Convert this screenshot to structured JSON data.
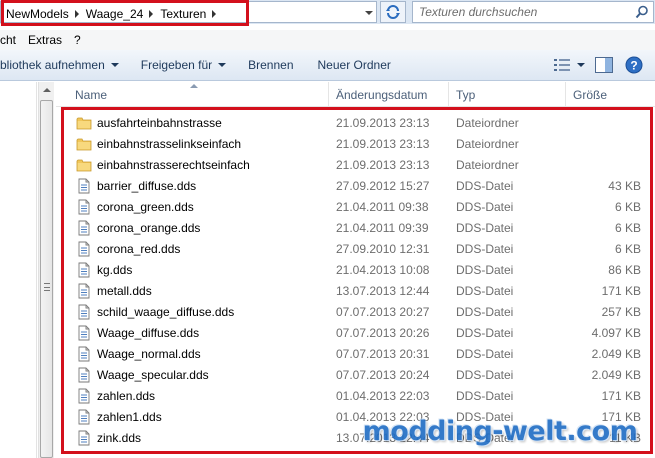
{
  "address_bar": {
    "breadcrumbs": [
      "NewModels",
      "Waage_24",
      "Texturen"
    ]
  },
  "search": {
    "placeholder": "Texturen durchsuchen"
  },
  "menu": {
    "items": [
      "cht",
      "Extras",
      "?"
    ]
  },
  "toolbar": {
    "library_label": "bliothek aufnehmen",
    "share_label": "Freigeben für",
    "burn_label": "Brennen",
    "new_folder_label": "Neuer Ordner"
  },
  "columns": {
    "name": "Name",
    "date": "Änderungsdatum",
    "type": "Typ",
    "size": "Größe"
  },
  "files": [
    {
      "name": "ausfahrteinbahnstrasse",
      "date": "21.09.2013 23:13",
      "type": "Dateiordner",
      "size": "",
      "icon": "folder-icon"
    },
    {
      "name": "einbahnstrasselinkseinfach",
      "date": "21.09.2013 23:13",
      "type": "Dateiordner",
      "size": "",
      "icon": "folder-icon"
    },
    {
      "name": "einbahnstrasserechtseinfach",
      "date": "21.09.2013 23:13",
      "type": "Dateiordner",
      "size": "",
      "icon": "folder-icon"
    },
    {
      "name": "barrier_diffuse.dds",
      "date": "27.09.2012 15:27",
      "type": "DDS-Datei",
      "size": "43 KB",
      "icon": "file-icon"
    },
    {
      "name": "corona_green.dds",
      "date": "21.04.2011 09:38",
      "type": "DDS-Datei",
      "size": "6 KB",
      "icon": "file-icon"
    },
    {
      "name": "corona_orange.dds",
      "date": "21.04.2011 09:39",
      "type": "DDS-Datei",
      "size": "6 KB",
      "icon": "file-icon"
    },
    {
      "name": "corona_red.dds",
      "date": "27.09.2010 12:31",
      "type": "DDS-Datei",
      "size": "6 KB",
      "icon": "file-icon"
    },
    {
      "name": "kg.dds",
      "date": "21.04.2013 10:08",
      "type": "DDS-Datei",
      "size": "86 KB",
      "icon": "file-icon"
    },
    {
      "name": "metall.dds",
      "date": "13.07.2013 12:44",
      "type": "DDS-Datei",
      "size": "171 KB",
      "icon": "file-icon"
    },
    {
      "name": "schild_waage_diffuse.dds",
      "date": "07.07.2013 20:27",
      "type": "DDS-Datei",
      "size": "257 KB",
      "icon": "file-icon"
    },
    {
      "name": "Waage_diffuse.dds",
      "date": "07.07.2013 20:26",
      "type": "DDS-Datei",
      "size": "4.097 KB",
      "icon": "file-icon"
    },
    {
      "name": "Waage_normal.dds",
      "date": "07.07.2013 20:31",
      "type": "DDS-Datei",
      "size": "2.049 KB",
      "icon": "file-icon"
    },
    {
      "name": "Waage_specular.dds",
      "date": "07.07.2013 20:24",
      "type": "DDS-Datei",
      "size": "2.049 KB",
      "icon": "file-icon"
    },
    {
      "name": "zahlen.dds",
      "date": "01.04.2013 22:03",
      "type": "DDS-Datei",
      "size": "171 KB",
      "icon": "file-icon"
    },
    {
      "name": "zahlen1.dds",
      "date": "01.04.2013 22:03",
      "type": "DDS-Datei",
      "size": "171 KB",
      "icon": "file-icon"
    },
    {
      "name": "zink.dds",
      "date": "13.07.2013 12:44",
      "type": "DDS-Datei",
      "size": "11 KB",
      "icon": "file-icon"
    }
  ],
  "watermark": "modding-welt.com",
  "colors": {
    "highlight": "#d3101c",
    "folder": "#f1c75b",
    "toolbar_text": "#1e395b",
    "watermark": "#1f6cc4"
  }
}
